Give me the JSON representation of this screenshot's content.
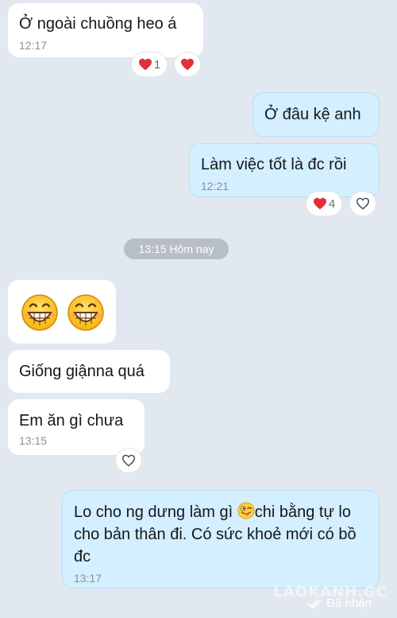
{
  "messages": [
    {
      "text": "Ở ngoài chuồng heo á",
      "time": "12:17"
    },
    {
      "text": "Ở đâu kệ anh"
    },
    {
      "text": "Làm việc tốt là đc rồi",
      "time": "12:21"
    },
    {
      "text": "Giống giậnna quá"
    },
    {
      "text": "Em ăn gì chưa",
      "time": "13:15"
    },
    {
      "text_before": "Lo cho ng dưng làm gì ",
      "text_after": "chi bằng tự lo cho bản thân đi. Có sức khoẻ mới có bồ đc",
      "time": "13:17"
    }
  ],
  "reactions": {
    "msg1_count": "1",
    "msg3_count": "4"
  },
  "date_separator": "13:15 Hôm nay",
  "status": "Đã nhận",
  "watermark": "LAOKANH.GC",
  "icons": [
    "heart-icon",
    "heart-outline-icon",
    "grin-emoji",
    "tongue-wink-emoji",
    "double-check-icon"
  ],
  "colors": {
    "background": "#e2e8ef",
    "incoming_bubble": "#ffffff",
    "outgoing_bubble": "#d4efff",
    "heart": "#e0303a",
    "date_chip": "#b7bec7"
  }
}
